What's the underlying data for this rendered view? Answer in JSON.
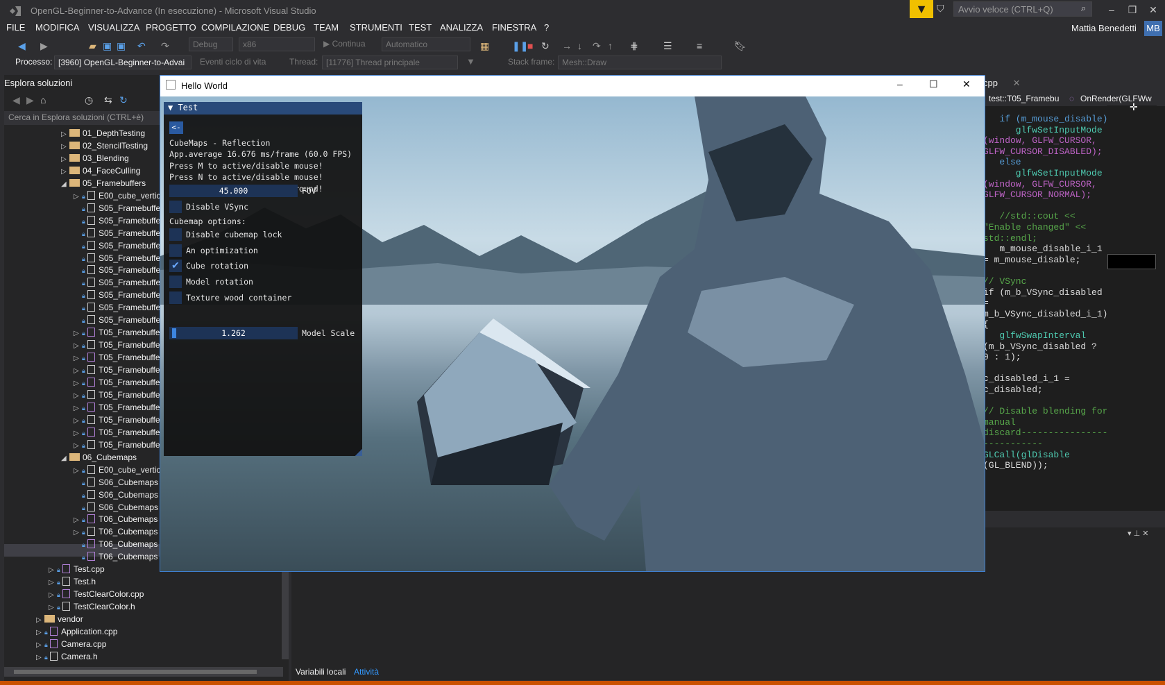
{
  "window": {
    "title": "OpenGL-Beginner-to-Advance (In esecuzione) - Microsoft Visual Studio",
    "quick_launch": "Avvio veloce (CTRL+Q)",
    "user": "Mattia Benedetti",
    "user_initials": "MB"
  },
  "menu": [
    "FILE",
    "MODIFICA",
    "VISUALIZZA",
    "PROGETTO",
    "COMPILAZIONE",
    "DEBUG",
    "TEAM",
    "STRUMENTI",
    "TEST",
    "ANALIZZA",
    "FINESTRA",
    "?"
  ],
  "toolbar": {
    "config": "Debug",
    "platform": "x86",
    "continue": "Continua",
    "mode": "Automatico"
  },
  "debugbar": {
    "process_label": "Processo:",
    "process": "[3960] OpenGL-Beginner-to-Advai",
    "lifecycle": "Eventi ciclo di vita",
    "thread_label": "Thread:",
    "thread": "[11776] Thread principale",
    "stack_label": "Stack frame:",
    "stack": "Mesh::Draw"
  },
  "solution": {
    "header": "Esplora soluzioni",
    "search": "Cerca in Esplora soluzioni (CTRL+è)",
    "items": [
      {
        "label": "01_DepthTesting",
        "type": "folder",
        "arrow": "▷"
      },
      {
        "label": "02_StencilTesting",
        "type": "folder",
        "arrow": "▷"
      },
      {
        "label": "03_Blending",
        "type": "folder",
        "arrow": "▷"
      },
      {
        "label": "04_FaceCulling",
        "type": "folder",
        "arrow": "▷"
      },
      {
        "label": "05_Framebuffers",
        "type": "folder",
        "arrow": "◢"
      },
      {
        "label": "E00_cube_vertic",
        "type": "file",
        "arrow": "▷"
      },
      {
        "label": "S05_Framebuffe",
        "type": "file",
        "arrow": ""
      },
      {
        "label": "S05_Framebuffe",
        "type": "file",
        "arrow": ""
      },
      {
        "label": "S05_Framebuffe",
        "type": "file",
        "arrow": ""
      },
      {
        "label": "S05_Framebuffe",
        "type": "file",
        "arrow": ""
      },
      {
        "label": "S05_Framebuffe",
        "type": "file",
        "arrow": ""
      },
      {
        "label": "S05_Framebuffe",
        "type": "file",
        "arrow": ""
      },
      {
        "label": "S05_Framebuffe",
        "type": "file",
        "arrow": ""
      },
      {
        "label": "S05_Framebuffe",
        "type": "file",
        "arrow": ""
      },
      {
        "label": "S05_Framebuffe",
        "type": "file",
        "arrow": ""
      },
      {
        "label": "S05_Framebuffe",
        "type": "file",
        "arrow": ""
      },
      {
        "label": "T05_Framebuffe",
        "type": "cpp",
        "arrow": "▷"
      },
      {
        "label": "T05_Framebuffe",
        "type": "file",
        "arrow": "▷"
      },
      {
        "label": "T05_Framebuffe",
        "type": "cpp",
        "arrow": "▷"
      },
      {
        "label": "T05_Framebuffe",
        "type": "file",
        "arrow": "▷"
      },
      {
        "label": "T05_Framebuffe",
        "type": "cpp",
        "arrow": "▷"
      },
      {
        "label": "T05_Framebuffe",
        "type": "file",
        "arrow": "▷"
      },
      {
        "label": "T05_Framebuffe",
        "type": "cpp",
        "arrow": "▷"
      },
      {
        "label": "T05_Framebuffe",
        "type": "file",
        "arrow": "▷"
      },
      {
        "label": "T05_Framebuffe",
        "type": "cpp",
        "arrow": "▷"
      },
      {
        "label": "T05_Framebuffe",
        "type": "file",
        "arrow": "▷"
      },
      {
        "label": "06_Cubemaps",
        "type": "folder",
        "arrow": "◢"
      },
      {
        "label": "E00_cube_vertic",
        "type": "file",
        "arrow": "▷"
      },
      {
        "label": "S06_Cubemaps",
        "type": "file",
        "arrow": ""
      },
      {
        "label": "S06_Cubemaps",
        "type": "file",
        "arrow": ""
      },
      {
        "label": "S06_Cubemaps",
        "type": "file",
        "arrow": ""
      },
      {
        "label": "T06_Cubemaps",
        "type": "cpp",
        "arrow": "▷"
      },
      {
        "label": "T06_Cubemaps",
        "type": "file",
        "arrow": "▷"
      },
      {
        "label": "T06_Cubemaps",
        "type": "cpp",
        "arrow": ""
      },
      {
        "label": "T06_Cubemaps",
        "type": "cpp",
        "arrow": ""
      },
      {
        "label": "Test.cpp",
        "type": "cpp",
        "arrow": "▷"
      },
      {
        "label": "Test.h",
        "type": "file",
        "arrow": "▷"
      },
      {
        "label": "TestClearColor.cpp",
        "type": "cpp",
        "arrow": "▷"
      },
      {
        "label": "TestClearColor.h",
        "type": "file",
        "arrow": "▷"
      },
      {
        "label": "vendor",
        "type": "folder",
        "arrow": "▷"
      },
      {
        "label": "Application.cpp",
        "type": "cpp",
        "arrow": "▷"
      },
      {
        "label": "Camera.cpp",
        "type": "cpp",
        "arrow": "▷"
      },
      {
        "label": "Camera.h",
        "type": "file",
        "arrow": "▷"
      }
    ]
  },
  "code": {
    "tab": "cpp",
    "nav_left": "test::T05_Framebu",
    "nav_right": "OnRender(GLFWw",
    "lines": [
      {
        "t": "   if (m_mouse_disable)",
        "c": "kw"
      },
      {
        "t": "      glfwSetInputMode",
        "c": "fn"
      },
      {
        "t": "(window, GLFW_CURSOR,",
        "c": "mc"
      },
      {
        "t": "GLFW_CURSOR_DISABLED);",
        "c": "mc"
      },
      {
        "t": "   else",
        "c": "kw"
      },
      {
        "t": "      glfwSetInputMode",
        "c": "fn"
      },
      {
        "t": "(window, GLFW_CURSOR,",
        "c": "mc"
      },
      {
        "t": "GLFW_CURSOR_NORMAL);",
        "c": "mc"
      },
      {
        "t": "",
        "c": ""
      },
      {
        "t": "   //std::cout <<",
        "c": "cm"
      },
      {
        "t": "\"Enable changed\" <<",
        "c": "cm"
      },
      {
        "t": "std::endl;",
        "c": "cm"
      },
      {
        "t": "   m_mouse_disable_i_1",
        "c": ""
      },
      {
        "t": "= m_mouse_disable;",
        "c": ""
      },
      {
        "t": "",
        "c": ""
      },
      {
        "t": "// VSync",
        "c": "cm"
      },
      {
        "t": "if (m_b_VSync_disabled !",
        "c": ""
      },
      {
        "t": "=",
        "c": ""
      },
      {
        "t": "m_b_VSync_disabled_i_1)",
        "c": ""
      },
      {
        "t": "{",
        "c": ""
      },
      {
        "t": "   glfwSwapInterval",
        "c": "fn"
      },
      {
        "t": "(m_b_VSync_disabled ?",
        "c": ""
      },
      {
        "t": "0 : 1);",
        "c": ""
      },
      {
        "t": "",
        "c": ""
      },
      {
        "t": "c_disabled_i_1 =",
        "c": ""
      },
      {
        "t": "c_disabled;",
        "c": ""
      },
      {
        "t": "",
        "c": ""
      },
      {
        "t": "// Disable blending for",
        "c": "cm"
      },
      {
        "t": "manual",
        "c": "cm"
      },
      {
        "t": "discard------------------",
        "c": "cm"
      },
      {
        "t": "-----------",
        "c": "cm"
      },
      {
        "t": "GLCall(glDisable",
        "c": "fn"
      },
      {
        "t": "(GL_BLEND));",
        "c": ""
      }
    ]
  },
  "bottom": {
    "tab1": "Variabili locali",
    "tab2": "Attività"
  },
  "hello": {
    "title": "Hello World"
  },
  "imgui": {
    "header": "Test",
    "back": "<-",
    "lines": [
      "CubeMaps - Reflection",
      "App.average 16.676 ms/frame (60.0 FPS)",
      "Press M to active/disable mouse!",
      "Press N to active/disable mouse!",
      "Press F to fix player to ground!"
    ],
    "fov_value": "45.000",
    "fov_label": "FOV",
    "vsync": "Disable VSync",
    "cubemap_options": "Cubemap options:",
    "opts": [
      {
        "label": "Disable cubemap lock",
        "checked": false
      },
      {
        "label": "An optimization",
        "checked": false
      },
      {
        "label": "Cube rotation",
        "checked": true
      },
      {
        "label": "Model rotation",
        "checked": false
      },
      {
        "label": "Texture wood container",
        "checked": false
      }
    ],
    "scale_value": "1.262",
    "scale_label": "Model Scale"
  },
  "colors": {
    "accent": "#007acc",
    "status": "#ca5100",
    "imgui_header": "#294a7a"
  }
}
